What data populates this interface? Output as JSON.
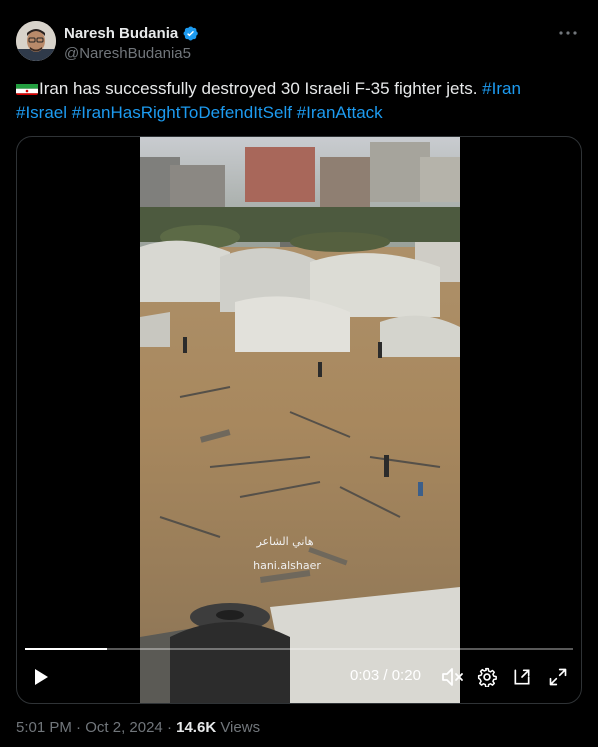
{
  "author": {
    "display_name": "Naresh Budania",
    "handle": "@NareshBudania5",
    "verified_icon": "verified-badge-icon",
    "avatar_icon": "avatar"
  },
  "tweet": {
    "text_main": "Iran has successfully destroyed 30 Israeli F-35 fighter jets.",
    "flag_icon": "iran-flag-icon",
    "hashtags": [
      "#Iran",
      "#Israel",
      "#IranHasRightToDefendItSelf",
      "#IranAttack"
    ]
  },
  "video": {
    "watermark_arabic": "هاني الشاعر",
    "watermark_latin": "hani.alshaer",
    "current_time": "0:03",
    "separator": "/",
    "duration": "0:20",
    "progress": 0.15
  },
  "footer": {
    "time": "5:01 PM",
    "dot": "·",
    "date": "Oct 2, 2024",
    "views_count": "14.6K",
    "views_label": "Views"
  },
  "colors": {
    "accent": "#1d9bf0",
    "text_primary": "#e7e9ea",
    "text_secondary": "#71767b",
    "background": "#000000",
    "border": "#2f3336"
  }
}
